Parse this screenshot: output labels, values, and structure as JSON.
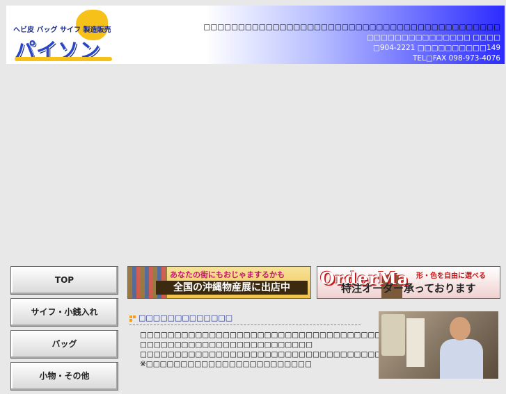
{
  "header": {
    "logo_sub": "ヘビ皮 バッグ サイフ 製造販売",
    "logo_main": "パイソン",
    "line1": "□□□□□□□□□□□□□□□□□□□□□□□□□□□□□□□□□□□□□□□□□□□",
    "line2": "□□□□□□□□□□□□□□□ □□□□",
    "line3": "□904-2221 □□□□□□□□□□149",
    "line4": "TEL□FAX 098-973-4076"
  },
  "nav": {
    "items": [
      {
        "label": "TOP"
      },
      {
        "label": "サイフ・小銭入れ"
      },
      {
        "label": "バッグ"
      },
      {
        "label": "小物・その他"
      }
    ]
  },
  "banner1": {
    "top": "あなたの街にもおじゃまするかも",
    "main": "全国の沖縄物産展に出店中"
  },
  "banner2": {
    "logo": "OrderMa",
    "sub": "形・色を自由に選べる",
    "main": "特注オーダー承っております"
  },
  "section": {
    "title": "□□□□□□□□□□□□□",
    "lines": [
      "□□□□□□□□□□□□□□□□□□□□□□□□□□□□□□□□□□□□□□□□",
      "□□□□□□□□□□□□□□□□□□□□□□□□□",
      "□□□□□□□□□□□□□□□□□□□□□□□□□□□□□□□□□□□□□□□",
      "※□□□□□□□□□□□□□□□□□□□□□□□□"
    ]
  }
}
